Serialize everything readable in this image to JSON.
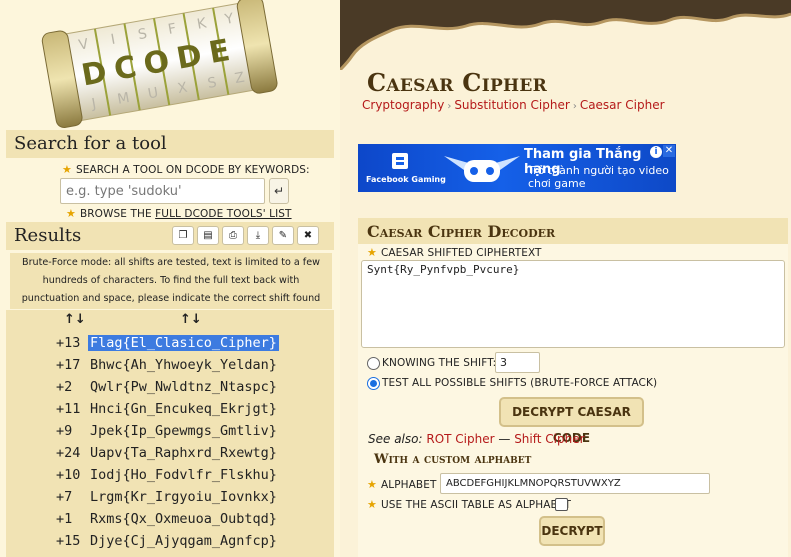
{
  "logo": {
    "text": "DCODE"
  },
  "search": {
    "heading": "Search for a tool",
    "keywords_label": "SEARCH A TOOL ON DCODE BY KEYWORDS:",
    "placeholder": "e.g. type 'sudoku'",
    "browse_prefix": "BROWSE THE ",
    "browse_link": "FULL DCODE TOOLS' LIST"
  },
  "results": {
    "heading": "Results",
    "tools": [
      "copy-icon",
      "download-file-icon",
      "print-icon",
      "save-icon",
      "pin-icon",
      "close-icon"
    ],
    "note": "Brute-Force mode: all shifts are tested, text is limited to a few hundreds of characters. To find the full text back with punctuation and space, please indicate the correct shift found (+XX) in the form.",
    "col_shift": "↑↓",
    "col_text": "↑↓",
    "rows": [
      {
        "shift": "+13",
        "text": "Flag{El_Clasico_Cipher}"
      },
      {
        "shift": "+17",
        "text": "Bhwc{Ah_Yhwoeyk_Yeldan}"
      },
      {
        "shift": "+2",
        "text": "Qwlr{Pw_Nwldtnz_Ntaspc}"
      },
      {
        "shift": "+11",
        "text": "Hnci{Gn_Encukeq_Ekrjgt}"
      },
      {
        "shift": "+9",
        "text": "Jpek{Ip_Gpewmgs_Gmtliv}"
      },
      {
        "shift": "+24",
        "text": "Uapv{Ta_Raphxrd_Rxewtg}"
      },
      {
        "shift": "+10",
        "text": "Iodj{Ho_Fodvlfr_Flskhu}"
      },
      {
        "shift": "+7",
        "text": "Lrgm{Kr_Irgyoiu_Iovnkx}"
      },
      {
        "shift": "+1",
        "text": "Rxms{Qx_Oxmeuoa_Oubtqd}"
      },
      {
        "shift": "+15",
        "text": "Djye{Cj_Ajyqgam_Agnfcp}"
      }
    ]
  },
  "page": {
    "title": "Caesar Cipher",
    "breadcrumb": [
      "Cryptography",
      "Substitution Cipher",
      "Caesar Cipher"
    ]
  },
  "ad": {
    "brand": "Facebook Gaming",
    "title": "Tham gia Thắng hạng",
    "line1": "Trở thành người tạo video",
    "line2": "chơi game"
  },
  "decoder": {
    "heading": "Caesar Cipher Decoder",
    "ciphertext_label": "CAESAR SHIFTED CIPHERTEXT",
    "ciphertext": "Synt{Ry_Pynfvpb_Pvcure}",
    "known_shift_label": "KNOWING THE SHIFT:",
    "shift_value": "3",
    "all_shifts_label": "TEST ALL POSSIBLE SHIFTS (BRUTE-FORCE ATTACK)",
    "decrypt_button": "DECRYPT CAESAR CODE",
    "see_also_label": "See also:",
    "see_also_links": [
      "ROT Cipher",
      "Shift Cipher"
    ],
    "see_also_sep": " — ",
    "custom_heading": "With a custom alphabet",
    "alphabet_label": "ALPHABET",
    "alphabet_value": "ABCDEFGHIJKLMNOPQRSTUVWXYZ",
    "ascii_label": "USE THE ASCII TABLE AS ALPHABET",
    "ascii_checked": false,
    "decrypt2_button": "DECRYPT"
  }
}
